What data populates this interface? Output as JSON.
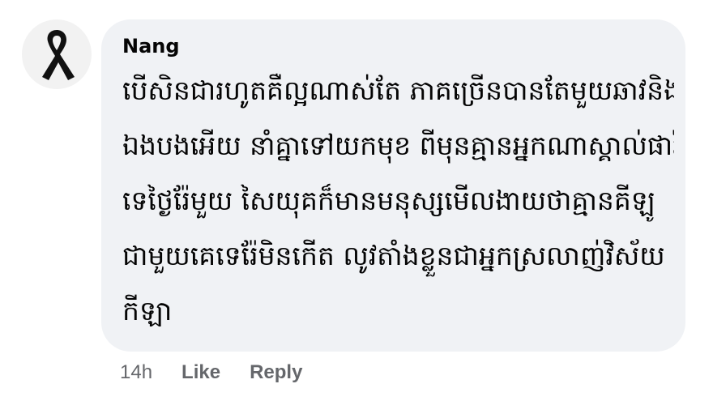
{
  "comment": {
    "author": "Nang",
    "avatar_icon": "black-ribbon-icon",
    "text_lines": [
      "បើសិនជារហូតគឺល្អណាស់តែ ភាគច្រើនបានតែមួយឆាវនិង",
      "ឯងបងអើយ នាំគ្នាទៅយកមុខ ពីមុនគ្មានអ្នកណាស្គាល់ផារ៉ា",
      "ទេថ្ងៃរ៉ែមួយ សៃយុគក៏មានមនុស្សមើលងាយថាគ្មានគីឡូ",
      "ជាមួយគេទេរ៉ែមិនកើត លូវតាំងខ្លួនជាអ្នកស្រលាញ់វិស័យ",
      "កីឡា"
    ],
    "timestamp": "14h",
    "like_label": "Like",
    "reply_label": "Reply"
  },
  "colors": {
    "bubble_bg": "#f0f2f5",
    "text": "#050505",
    "secondary_text": "#65676b",
    "ribbon": "#111111"
  }
}
